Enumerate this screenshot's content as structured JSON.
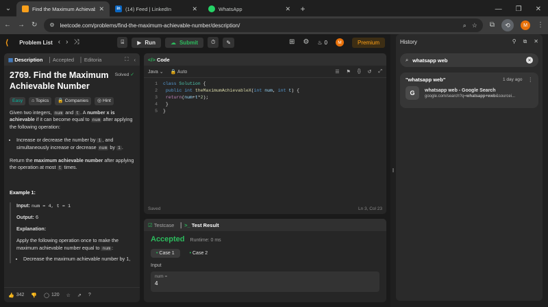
{
  "browser": {
    "tabs": [
      {
        "title": "Find the Maximum Achievable",
        "favicon_color": "#f89f1b"
      },
      {
        "title": "(14) Feed | LinkedIn",
        "favicon_color": "#0a66c2"
      },
      {
        "title": "WhatsApp",
        "favicon_color": "#25d366"
      }
    ],
    "url": "leetcode.com/problems/find-the-maximum-achievable-number/description/",
    "profile_initial": "M"
  },
  "leetcode": {
    "problem_list": "Problem List",
    "run": "Run",
    "submit": "Submit",
    "streak": "0",
    "premium": "Premium",
    "avatar": "M",
    "desc_tabs": {
      "description": "Description",
      "accepted": "Accepted",
      "editorial": "Editoria"
    },
    "title": "2769. Find the Maximum Achievable Number",
    "solved": "Solved",
    "tags": {
      "difficulty": "Easy",
      "topics": "Topics",
      "companies": "Companies",
      "hint": "Hint"
    },
    "p1": {
      "a": "Given two integers, ",
      "num": "num",
      "b": " and ",
      "t": "t",
      "c": ". A ",
      "bold": "number x is achievable",
      "d": " if it can become equal to ",
      "num2": "num",
      "e": " after applying the following operation:"
    },
    "bullet1": {
      "a": "Increase or decrease the number by ",
      "one": "1",
      "b": ", and simultaneously increase or decrease ",
      "num": "num",
      "c": " by ",
      "one2": "1",
      "d": "."
    },
    "p2": {
      "a": "Return the ",
      "bold": "maximum achievable number",
      "b": " after applying the operation at most ",
      "t": "t",
      "c": " times."
    },
    "example_title": "Example 1:",
    "input_label": "Input:",
    "input_val": "num = 4, t = 1",
    "output_label": "Output:",
    "output_val": "6",
    "explanation_label": "Explanation:",
    "explanation_text": {
      "a": "Apply the following operation once to make the maximum achievable number equal to ",
      "num": "num",
      "b": ":"
    },
    "bullet2": "Decrease the maximum achievable number by 1,",
    "likes": "342",
    "comments": "120",
    "code_header": "Code",
    "lang": "Java",
    "auto": "Auto",
    "code_lines": [
      [
        "1",
        "class Solution {"
      ],
      [
        "2",
        "    public int theMaximumAchievableX(int num, int t) {"
      ],
      [
        "3",
        "        return(num+t*2);"
      ],
      [
        "4",
        "    }"
      ],
      [
        "5",
        "}"
      ]
    ],
    "saved": "Saved",
    "cursor": "Ln 3, Col 23",
    "testcase": "Testcase",
    "test_result": "Test Result",
    "accepted": "Accepted",
    "runtime": "Runtime: 0 ms",
    "case1": "Case 1",
    "case2": "Case 2",
    "input": "Input",
    "var_name": "num =",
    "var_val": "4"
  },
  "history": {
    "title": "History",
    "query": "whatsapp web",
    "group_label": "\"whatsapp web\"",
    "group_time": "1 day ago",
    "item_title": "whatsapp web - Google Search",
    "item_url_a": "google.com/search?q=",
    "item_url_b": "whatsapp+web",
    "item_url_c": "&sourcei..."
  }
}
